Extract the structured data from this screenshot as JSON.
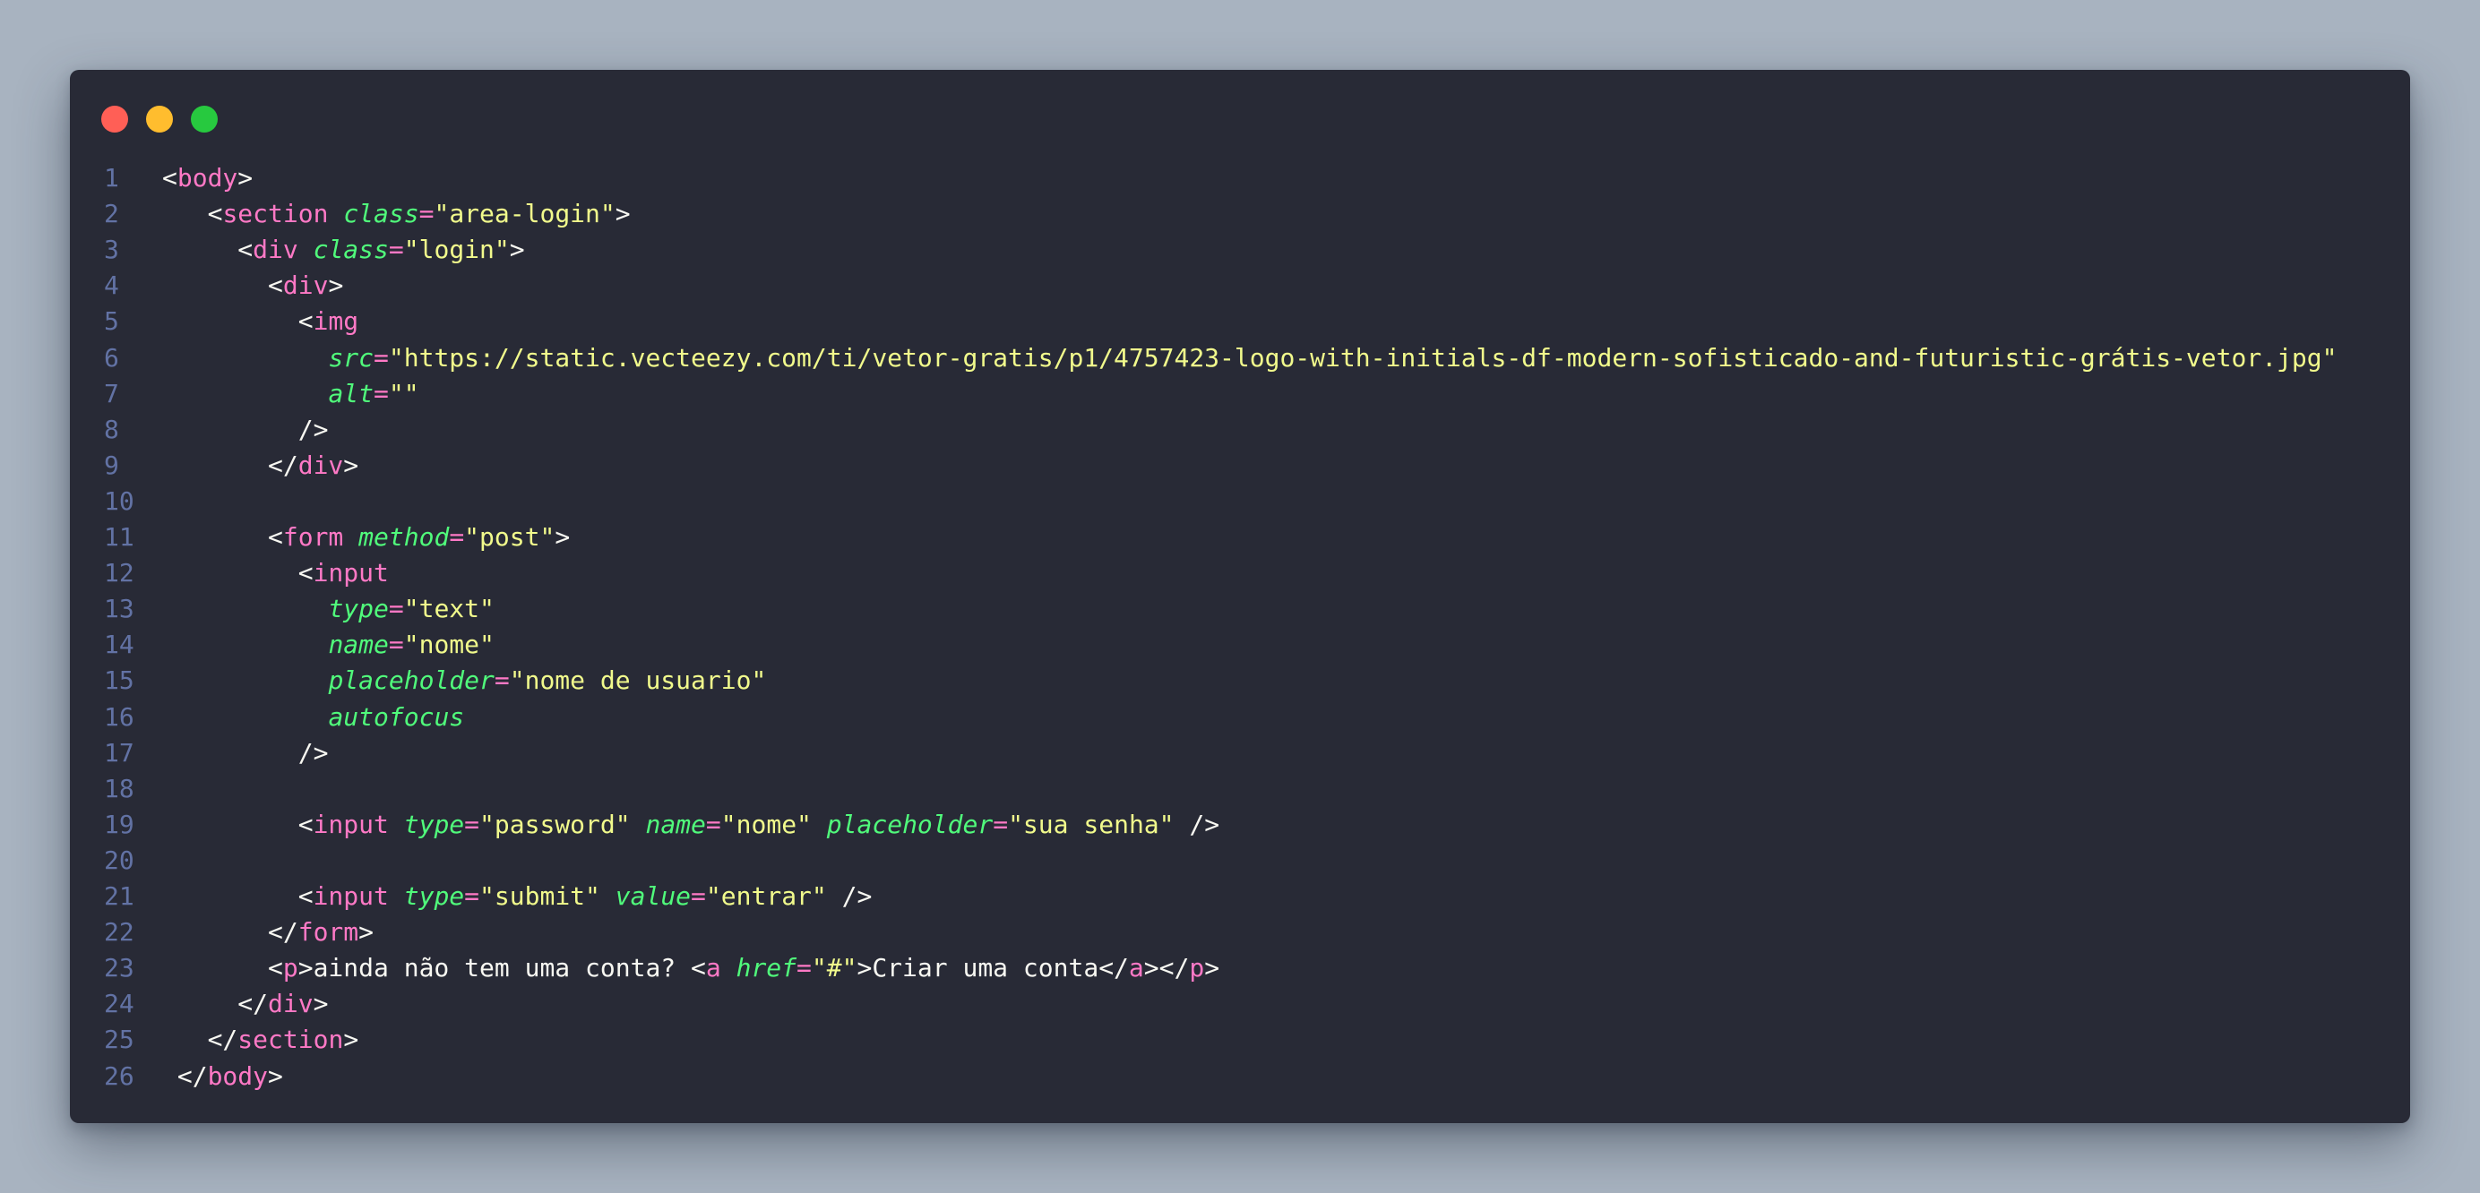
{
  "window": {
    "traffic_lights": [
      "close",
      "minimize",
      "maximize"
    ],
    "colors": {
      "background": "#282a36",
      "tag": "#ff79c6",
      "attribute": "#50fa7b",
      "string": "#f1fa8c",
      "text": "#f8f8f2",
      "line_number": "#6272a4"
    }
  },
  "code": {
    "lines": [
      {
        "n": "1",
        "tokens": [
          [
            "p",
            "<"
          ],
          [
            "t",
            "body"
          ],
          [
            "p",
            ">"
          ]
        ]
      },
      {
        "n": "2",
        "tokens": [
          [
            "p",
            "   <"
          ],
          [
            "t",
            "section"
          ],
          [
            "p",
            " "
          ],
          [
            "a",
            "class"
          ],
          [
            "e",
            "="
          ],
          [
            "s",
            "\"area-login\""
          ],
          [
            "p",
            ">"
          ]
        ]
      },
      {
        "n": "3",
        "tokens": [
          [
            "p",
            "     <"
          ],
          [
            "t",
            "div"
          ],
          [
            "p",
            " "
          ],
          [
            "a",
            "class"
          ],
          [
            "e",
            "="
          ],
          [
            "s",
            "\"login\""
          ],
          [
            "p",
            ">"
          ]
        ]
      },
      {
        "n": "4",
        "tokens": [
          [
            "p",
            "       <"
          ],
          [
            "t",
            "div"
          ],
          [
            "p",
            ">"
          ]
        ]
      },
      {
        "n": "5",
        "tokens": [
          [
            "p",
            "         <"
          ],
          [
            "t",
            "img"
          ]
        ]
      },
      {
        "n": "6",
        "tokens": [
          [
            "p",
            "           "
          ],
          [
            "a",
            "src"
          ],
          [
            "e",
            "="
          ],
          [
            "s",
            "\"https://static.vecteezy.com/ti/vetor-gratis/p1/4757423-logo-with-initials-df-modern-sofisticado-and-futuristic-grátis-vetor.jpg\""
          ]
        ]
      },
      {
        "n": "7",
        "tokens": [
          [
            "p",
            "           "
          ],
          [
            "a",
            "alt"
          ],
          [
            "e",
            "="
          ],
          [
            "s",
            "\"\""
          ]
        ]
      },
      {
        "n": "8",
        "tokens": [
          [
            "p",
            "         />"
          ]
        ]
      },
      {
        "n": "9",
        "tokens": [
          [
            "p",
            "       </"
          ],
          [
            "t",
            "div"
          ],
          [
            "p",
            ">"
          ]
        ]
      },
      {
        "n": "10",
        "tokens": []
      },
      {
        "n": "11",
        "tokens": [
          [
            "p",
            "       <"
          ],
          [
            "t",
            "form"
          ],
          [
            "p",
            " "
          ],
          [
            "a",
            "method"
          ],
          [
            "e",
            "="
          ],
          [
            "s",
            "\"post\""
          ],
          [
            "p",
            ">"
          ]
        ]
      },
      {
        "n": "12",
        "tokens": [
          [
            "p",
            "         <"
          ],
          [
            "t",
            "input"
          ]
        ]
      },
      {
        "n": "13",
        "tokens": [
          [
            "p",
            "           "
          ],
          [
            "a",
            "type"
          ],
          [
            "e",
            "="
          ],
          [
            "s",
            "\"text\""
          ]
        ]
      },
      {
        "n": "14",
        "tokens": [
          [
            "p",
            "           "
          ],
          [
            "a",
            "name"
          ],
          [
            "e",
            "="
          ],
          [
            "s",
            "\"nome\""
          ]
        ]
      },
      {
        "n": "15",
        "tokens": [
          [
            "p",
            "           "
          ],
          [
            "a",
            "placeholder"
          ],
          [
            "e",
            "="
          ],
          [
            "s",
            "\"nome de usuario\""
          ]
        ]
      },
      {
        "n": "16",
        "tokens": [
          [
            "p",
            "           "
          ],
          [
            "a",
            "autofocus"
          ]
        ]
      },
      {
        "n": "17",
        "tokens": [
          [
            "p",
            "         />"
          ]
        ]
      },
      {
        "n": "18",
        "tokens": []
      },
      {
        "n": "19",
        "tokens": [
          [
            "p",
            "         <"
          ],
          [
            "t",
            "input"
          ],
          [
            "p",
            " "
          ],
          [
            "a",
            "type"
          ],
          [
            "e",
            "="
          ],
          [
            "s",
            "\"password\""
          ],
          [
            "p",
            " "
          ],
          [
            "a",
            "name"
          ],
          [
            "e",
            "="
          ],
          [
            "s",
            "\"nome\""
          ],
          [
            "p",
            " "
          ],
          [
            "a",
            "placeholder"
          ],
          [
            "e",
            "="
          ],
          [
            "s",
            "\"sua senha\""
          ],
          [
            "p",
            " />"
          ]
        ]
      },
      {
        "n": "20",
        "tokens": []
      },
      {
        "n": "21",
        "tokens": [
          [
            "p",
            "         <"
          ],
          [
            "t",
            "input"
          ],
          [
            "p",
            " "
          ],
          [
            "a",
            "type"
          ],
          [
            "e",
            "="
          ],
          [
            "s",
            "\"submit\""
          ],
          [
            "p",
            " "
          ],
          [
            "a",
            "value"
          ],
          [
            "e",
            "="
          ],
          [
            "s",
            "\"entrar\""
          ],
          [
            "p",
            " />"
          ]
        ]
      },
      {
        "n": "22",
        "tokens": [
          [
            "p",
            "       </"
          ],
          [
            "t",
            "form"
          ],
          [
            "p",
            ">"
          ]
        ]
      },
      {
        "n": "23",
        "tokens": [
          [
            "p",
            "       <"
          ],
          [
            "t",
            "p"
          ],
          [
            "p",
            ">ainda não tem uma conta? <"
          ],
          [
            "t",
            "a"
          ],
          [
            "p",
            " "
          ],
          [
            "a",
            "href"
          ],
          [
            "e",
            "="
          ],
          [
            "s",
            "\"#\""
          ],
          [
            "p",
            ">Criar uma conta</"
          ],
          [
            "t",
            "a"
          ],
          [
            "p",
            "></"
          ],
          [
            "t",
            "p"
          ],
          [
            "p",
            ">"
          ]
        ]
      },
      {
        "n": "24",
        "tokens": [
          [
            "p",
            "     </"
          ],
          [
            "t",
            "div"
          ],
          [
            "p",
            ">"
          ]
        ]
      },
      {
        "n": "25",
        "tokens": [
          [
            "p",
            "   </"
          ],
          [
            "t",
            "section"
          ],
          [
            "p",
            ">"
          ]
        ]
      },
      {
        "n": "26",
        "tokens": [
          [
            "p",
            " </"
          ],
          [
            "t",
            "body"
          ],
          [
            "p",
            ">"
          ]
        ]
      }
    ]
  }
}
